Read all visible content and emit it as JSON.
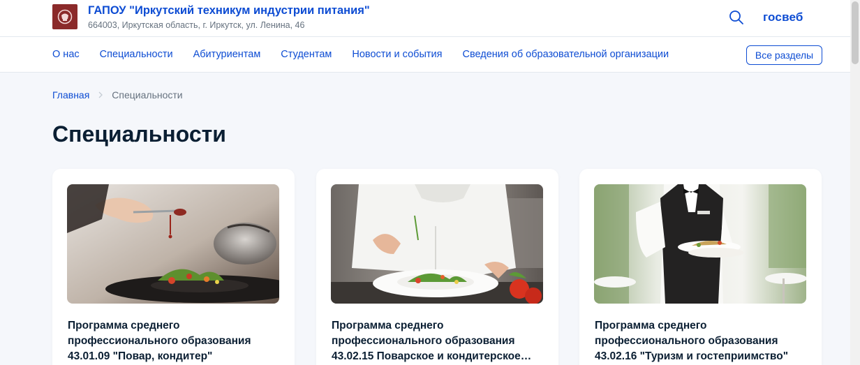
{
  "header": {
    "org_name": "ГАПОУ \"Иркутский техникум индустрии питания\"",
    "org_address": "664003, Иркутская область, г. Иркутск, ул. Ленина, 46",
    "brand": "госвеб"
  },
  "nav": {
    "items": [
      "О нас",
      "Специальности",
      "Абитуриентам",
      "Студентам",
      "Новости и события",
      "Сведения об образовательной организации"
    ],
    "all_sections_label": "Все разделы"
  },
  "breadcrumb": {
    "home": "Главная",
    "current": "Специальности"
  },
  "page": {
    "title": "Специальности"
  },
  "cards": [
    {
      "line1": "Программа среднего",
      "line2": "профессионального образования",
      "line3": "43.01.09 \"Повар, кондитер\""
    },
    {
      "line1": "Программа среднего",
      "line2": "профессионального образования",
      "line3": "43.02.15 Поварское и кондитерское…"
    },
    {
      "line1": "Программа среднего",
      "line2": "профессионального образования",
      "line3": "43.02.16 \"Туризм и гостеприимство\""
    }
  ],
  "colors": {
    "accent": "#0d4cd3",
    "text": "#0b1f33",
    "muted": "#66727f",
    "background": "#f5f7fb",
    "logo": "#8b2a2a"
  },
  "icons": {
    "search": "search-icon",
    "logo": "emblem-logo-icon",
    "breadcrumb_separator": "chevron-right-icon"
  }
}
